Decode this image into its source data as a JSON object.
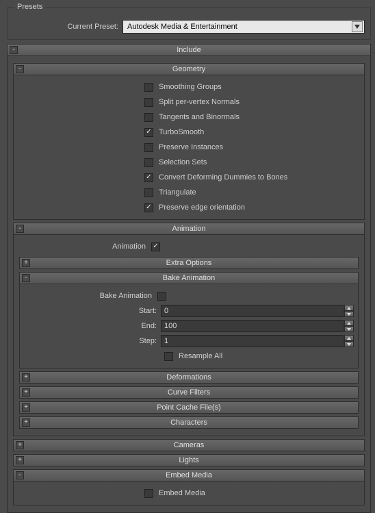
{
  "presets": {
    "fieldset_label": "Presets",
    "current_label": "Current Preset:",
    "current_value": "Autodesk Media & Entertainment"
  },
  "include": {
    "title": "Include",
    "geometry": {
      "title": "Geometry",
      "items": [
        {
          "label": "Smoothing Groups",
          "checked": false
        },
        {
          "label": "Split per-vertex Normals",
          "checked": false
        },
        {
          "label": "Tangents and Binormals",
          "checked": false
        },
        {
          "label": "TurboSmooth",
          "checked": true
        },
        {
          "label": "Preserve Instances",
          "checked": false
        },
        {
          "label": "Selection Sets",
          "checked": false
        },
        {
          "label": "Convert Deforming Dummies to Bones",
          "checked": true
        },
        {
          "label": "Triangulate",
          "checked": false
        },
        {
          "label": "Preserve edge orientation",
          "checked": true
        }
      ]
    },
    "animation": {
      "title": "Animation",
      "enable_label": "Animation",
      "enable_checked": true,
      "extra_options": "Extra Options",
      "bake": {
        "title": "Bake Animation",
        "enable_label": "Bake Animation",
        "enable_checked": false,
        "start_label": "Start:",
        "start_value": "0",
        "end_label": "End:",
        "end_value": "100",
        "step_label": "Step:",
        "step_value": "1",
        "resample_label": "Resample All",
        "resample_checked": false
      },
      "deformations": "Deformations",
      "curve_filters": "Curve Filters",
      "point_cache": "Point Cache File(s)",
      "characters": "Characters"
    },
    "cameras": "Cameras",
    "lights": "Lights",
    "embed_media": {
      "title": "Embed Media",
      "label": "Embed Media",
      "checked": false
    }
  }
}
